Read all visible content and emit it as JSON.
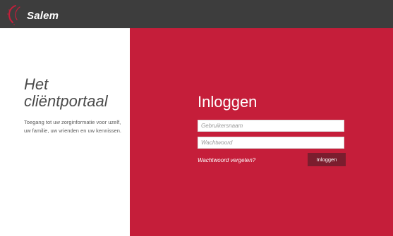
{
  "brand": {
    "logo_text": "Salem",
    "accent_color": "#c51e3a",
    "header_color": "#3d3d3d"
  },
  "intro": {
    "title_line1": "Het",
    "title_line2": "cliëntportaal",
    "description": "Toegang tot uw zorginformatie voor uzelf, uw familie, uw vrienden en uw kennissen."
  },
  "login": {
    "title": "Inloggen",
    "username_placeholder": "Gebruikersnaam",
    "password_placeholder": "Wachtwoord",
    "forgot_label": "Wachtwoord vergeten?",
    "submit_label": "Inloggen",
    "button_color": "#7b1d2e"
  }
}
